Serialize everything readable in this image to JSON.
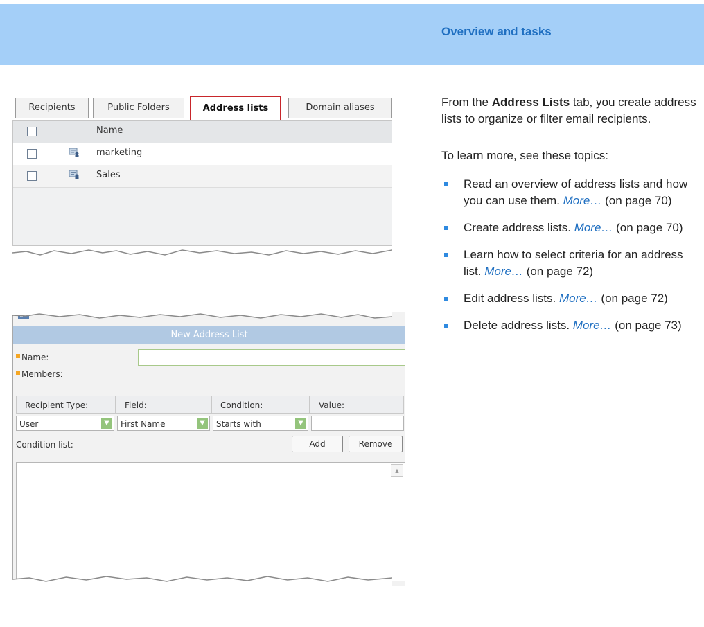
{
  "header": {
    "title": "Overview and tasks"
  },
  "intro": {
    "before": "From the ",
    "strong": "Address Lists",
    "after": " tab, you create address lists to organize or filter email recipients."
  },
  "learn_more": "To learn more, see these topics:",
  "topics": [
    {
      "text": "Read an overview of address lists and how you can use them. ",
      "more": "More…",
      "page": " (on page 70)"
    },
    {
      "text": "Create address lists. ",
      "more": "More…",
      "page": " (on page 70)"
    },
    {
      "text": "Learn how to select criteria for an address list. ",
      "more": "More…",
      "page": " (on page 72)"
    },
    {
      "text": "Edit address lists. ",
      "more": "More…",
      "page": " (on page 72)"
    },
    {
      "text": "Delete address lists. ",
      "more": "More…",
      "page": " (on page 73)"
    }
  ],
  "shot1": {
    "tabs": [
      "Recipients",
      "Public Folders",
      "Address lists",
      "Domain aliases"
    ],
    "active_tab": "Address lists",
    "column_name": "Name",
    "rows": [
      "marketing",
      "Sales"
    ]
  },
  "shot2": {
    "title": "New Address List",
    "name_label": "Name:",
    "members_label": "Members:",
    "columns": [
      "Recipient Type:",
      "Field:",
      "Condition:",
      "Value:"
    ],
    "selects": [
      "User",
      "First Name",
      "Starts with"
    ],
    "condition_list_label": "Condition list:",
    "add_label": "Add",
    "remove_label": "Remove"
  },
  "colors": {
    "header_band": "#a4cff8",
    "title": "#1f6fc1",
    "bullet": "#2f8ae0",
    "active_tab_border": "#c8262b"
  }
}
